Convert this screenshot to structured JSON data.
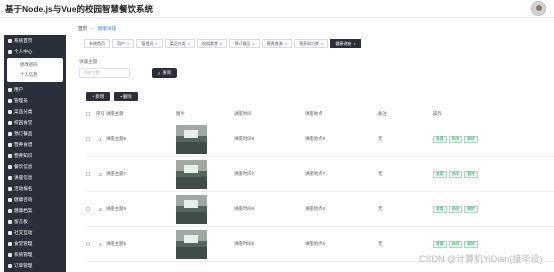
{
  "app": {
    "title": "基于Node.js与Vue的校园智慧餐饮系统"
  },
  "sidebar": {
    "items": [
      {
        "label": "系统首页"
      },
      {
        "label": "个人中心"
      },
      {
        "label": "用户"
      },
      {
        "label": "管理员"
      },
      {
        "label": "菜品分类"
      },
      {
        "label": "校园食堂"
      },
      {
        "label": "预订餐品"
      },
      {
        "label": "营养食谱"
      },
      {
        "label": "营养知识"
      },
      {
        "label": "餐饮信息"
      },
      {
        "label": "讲座信息"
      },
      {
        "label": "活动报名"
      },
      {
        "label": "健康咨询"
      },
      {
        "label": "健康档案"
      },
      {
        "label": "留言板"
      },
      {
        "label": "社交互动"
      },
      {
        "label": "食堂管理"
      },
      {
        "label": "系统管理"
      },
      {
        "label": "订单管理"
      }
    ],
    "sub_items": [
      {
        "label": "修改密码"
      },
      {
        "label": "个人信息"
      }
    ]
  },
  "breadcrumb": {
    "home": "首页",
    "sep": "—",
    "current": "健康讲座"
  },
  "tags": [
    {
      "label": "系统首页"
    },
    {
      "label": "用户"
    },
    {
      "label": "管理员"
    },
    {
      "label": "菜品分类"
    },
    {
      "label": "校园食堂"
    },
    {
      "label": "预订餐品"
    },
    {
      "label": "营养食谱"
    },
    {
      "label": "营养知识库"
    },
    {
      "label": "健康讲座",
      "active": true
    }
  ],
  "search": {
    "label": "讲座主题",
    "placeholder": "讲座主题",
    "button": "查询"
  },
  "actions": {
    "add": "新增",
    "delete": "删除"
  },
  "table": {
    "headers": [
      "序号",
      "讲座主题",
      "图片",
      "讲座时间",
      "讲座地点",
      "备注",
      "操作"
    ],
    "rows": [
      {
        "no": "1",
        "title": "讲座主题8",
        "time": "讲座时间8",
        "place": "讲座地点8",
        "note": "无"
      },
      {
        "no": "2",
        "title": "讲座主题7",
        "time": "讲座时间7",
        "place": "讲座地点7",
        "note": "无"
      },
      {
        "no": "3",
        "title": "讲座主题6",
        "time": "讲座时间6",
        "place": "讲座地点6",
        "note": "无"
      },
      {
        "no": "4",
        "title": "讲座主题5",
        "time": "讲座时间5",
        "place": "讲座地点5",
        "note": "无"
      }
    ],
    "ops": [
      "查看",
      "修改",
      "删除"
    ]
  },
  "watermark": "CSDN @计算机YiDian(接毕设)"
}
